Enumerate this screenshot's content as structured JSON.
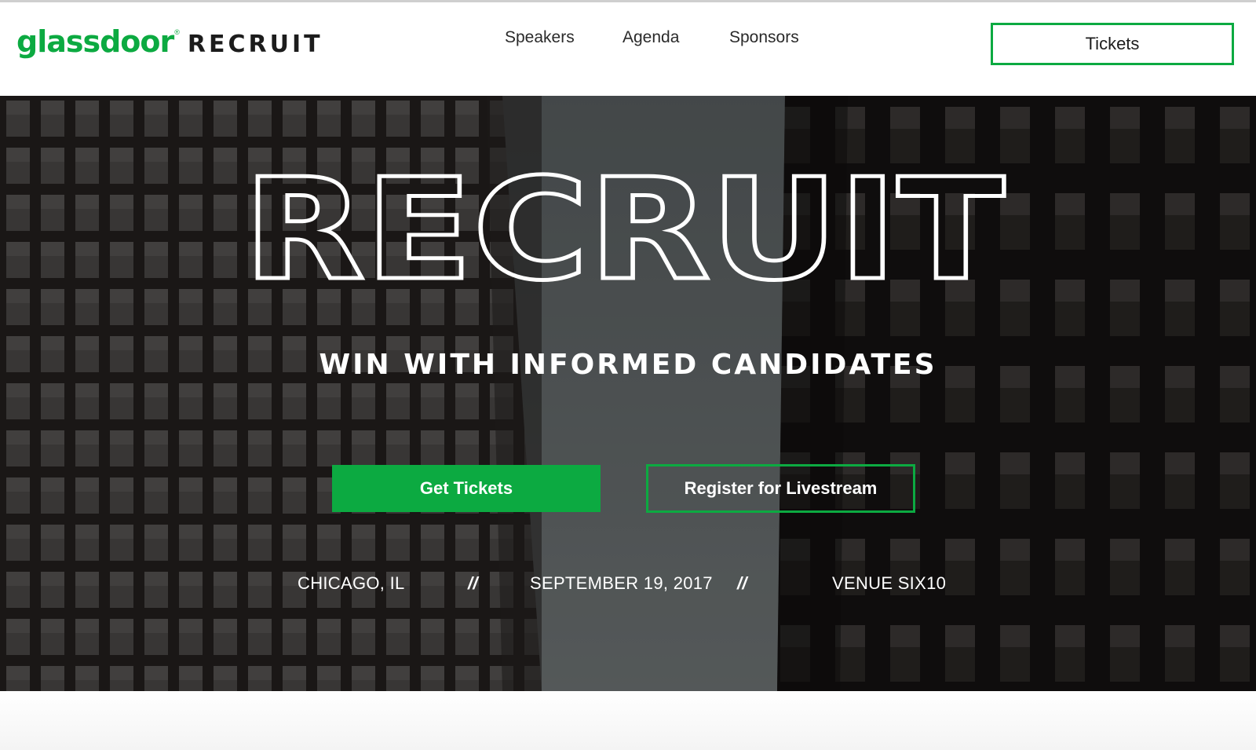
{
  "header": {
    "logo": {
      "brand": "glassdoor",
      "trademark": "®",
      "product": "RECRUIT"
    },
    "nav": [
      {
        "label": "Speakers"
      },
      {
        "label": "Agenda"
      },
      {
        "label": "Sponsors"
      }
    ],
    "tickets_label": "Tickets"
  },
  "hero": {
    "title": "RECRUIT",
    "tagline": "WIN WITH INFORMED CANDIDATES",
    "primary_button": "Get Tickets",
    "secondary_button": "Register for Livestream",
    "event": {
      "city": "CHICAGO, IL",
      "separator": "//",
      "date": "SEPTEMBER 19, 2017",
      "venue": "VENUE SIX10"
    }
  },
  "colors": {
    "brand_green": "#0caa41",
    "text_dark": "#1c1c1c",
    "hero_text": "#ffffff"
  }
}
